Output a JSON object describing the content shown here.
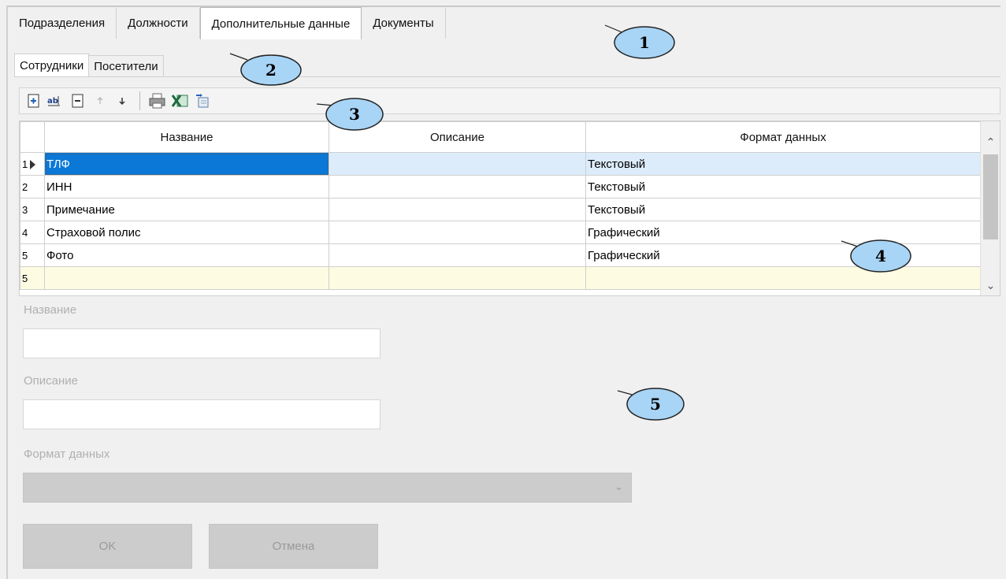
{
  "tabs_main": [
    "Подразделения",
    "Должности",
    "Дополнительные данные",
    "Документы"
  ],
  "tabs_main_active": 2,
  "tabs_sub": [
    "Сотрудники",
    "Посетители"
  ],
  "tabs_sub_active": 0,
  "toolbar": {
    "icons": [
      "add-icon",
      "rename-icon",
      "delete-icon",
      "move-up-icon",
      "move-down-icon",
      "print-icon",
      "excel-export-icon",
      "export-icon"
    ]
  },
  "grid": {
    "columns": [
      "Название",
      "Описание",
      "Формат данных"
    ],
    "rows": [
      {
        "num": "1",
        "name": "ТЛФ",
        "desc": "",
        "format": "Текстовый"
      },
      {
        "num": "2",
        "name": "ИНН",
        "desc": "",
        "format": "Текстовый"
      },
      {
        "num": "3",
        "name": "Примечание",
        "desc": "",
        "format": "Текстовый"
      },
      {
        "num": "4",
        "name": "Страховой полис",
        "desc": "",
        "format": "Графический"
      },
      {
        "num": "5",
        "name": "Фото",
        "desc": "",
        "format": "Графический"
      }
    ],
    "new_row_num": "5"
  },
  "form": {
    "name_label": "Название",
    "name_value": "",
    "desc_label": "Описание",
    "desc_value": "",
    "format_label": "Формат данных",
    "format_value": "",
    "ok_label": "OK",
    "cancel_label": "Отмена"
  },
  "callouts": [
    "1",
    "2",
    "3",
    "4",
    "5"
  ],
  "colors": {
    "selection": "#0b78d7",
    "row_highlight": "#dcecfb",
    "new_row": "#fdfbe2",
    "callout_fill": "#a8d4f5"
  }
}
